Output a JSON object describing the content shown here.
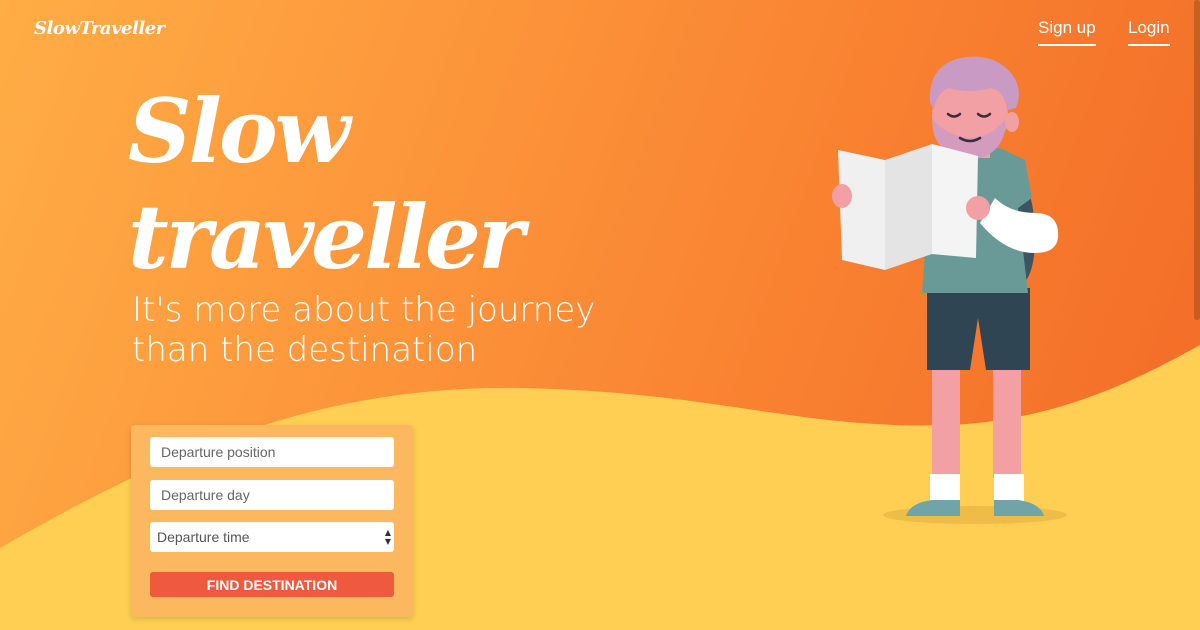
{
  "brand": {
    "logo": "SlowTraveller"
  },
  "nav": {
    "signup_label": "Sign up",
    "login_label": "Login"
  },
  "hero": {
    "title_line1": "Slow",
    "title_line2": "traveller",
    "subtitle_line1": "It's more about the journey",
    "subtitle_line2": "than the destination"
  },
  "search_form": {
    "departure_position": {
      "value": "",
      "placeholder": "Departure position"
    },
    "departure_day": {
      "value": "",
      "placeholder": "Departure day"
    },
    "departure_time": {
      "selected": "Departure time"
    },
    "submit_label": "FIND DESTINATION"
  },
  "colors": {
    "sky_start": "#ffad45",
    "sky_end": "#f26a27",
    "sand": "#fecf52",
    "form_background": "#fbb85f",
    "button": "#ef5a3f"
  },
  "icons": {
    "select_arrows": "updown-chevron-icon",
    "illustration": "traveller-with-map-illustration"
  }
}
